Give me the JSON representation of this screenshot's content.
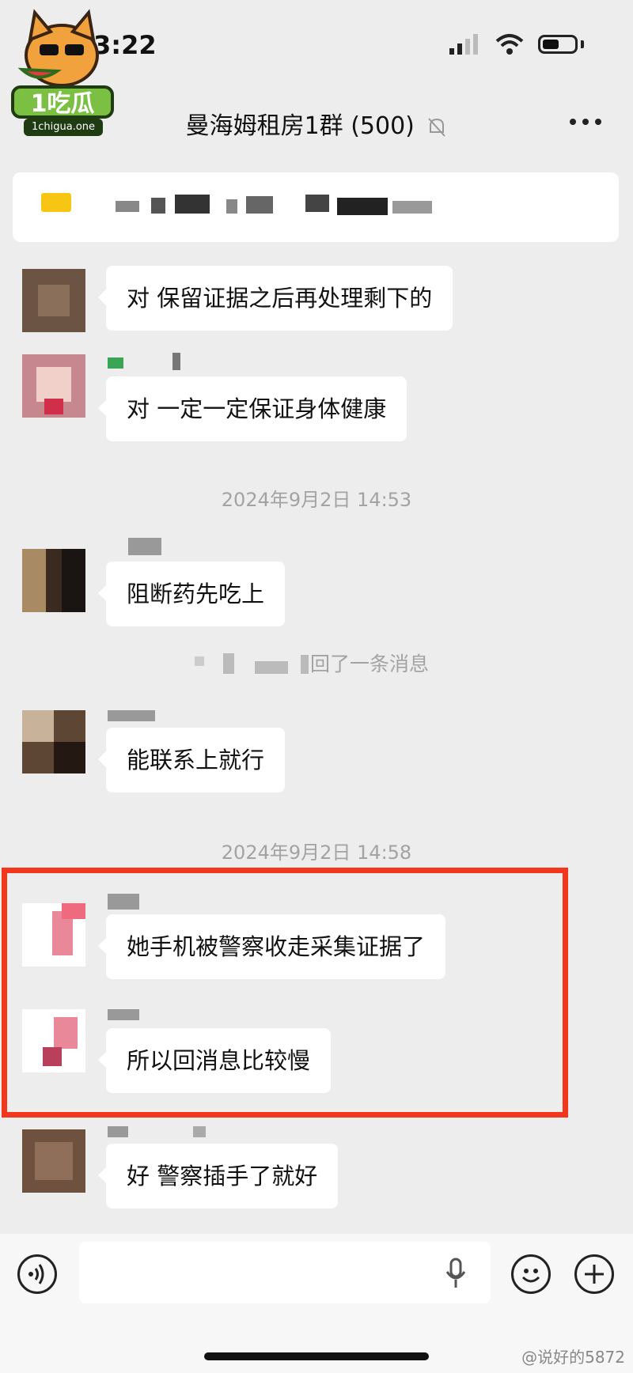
{
  "status_bar": {
    "time": "3:22"
  },
  "logo": {
    "text": "1吃瓜",
    "subtext": "1chigua.one"
  },
  "header": {
    "title": "曼海姆租房1群 (500)"
  },
  "messages": [
    {
      "text": "对 保留证据之后再处理剩下的"
    },
    {
      "text": "对 一定一定保证身体健康"
    },
    {
      "text": "阻断药先吃上"
    },
    {
      "text": "能联系上就行"
    },
    {
      "text": "她手机被警察收走采集证据了"
    },
    {
      "text": "所以回消息比较慢"
    },
    {
      "text": "好 警察插手了就好"
    }
  ],
  "timestamps": [
    "2024年9月2日 14:53",
    "2024年9月2日 14:58"
  ],
  "system_message": "回了一条消息",
  "watermark": "@说好的5872",
  "colors": {
    "highlight": "#f3371c",
    "background": "#ededed",
    "bubble": "#ffffff"
  }
}
